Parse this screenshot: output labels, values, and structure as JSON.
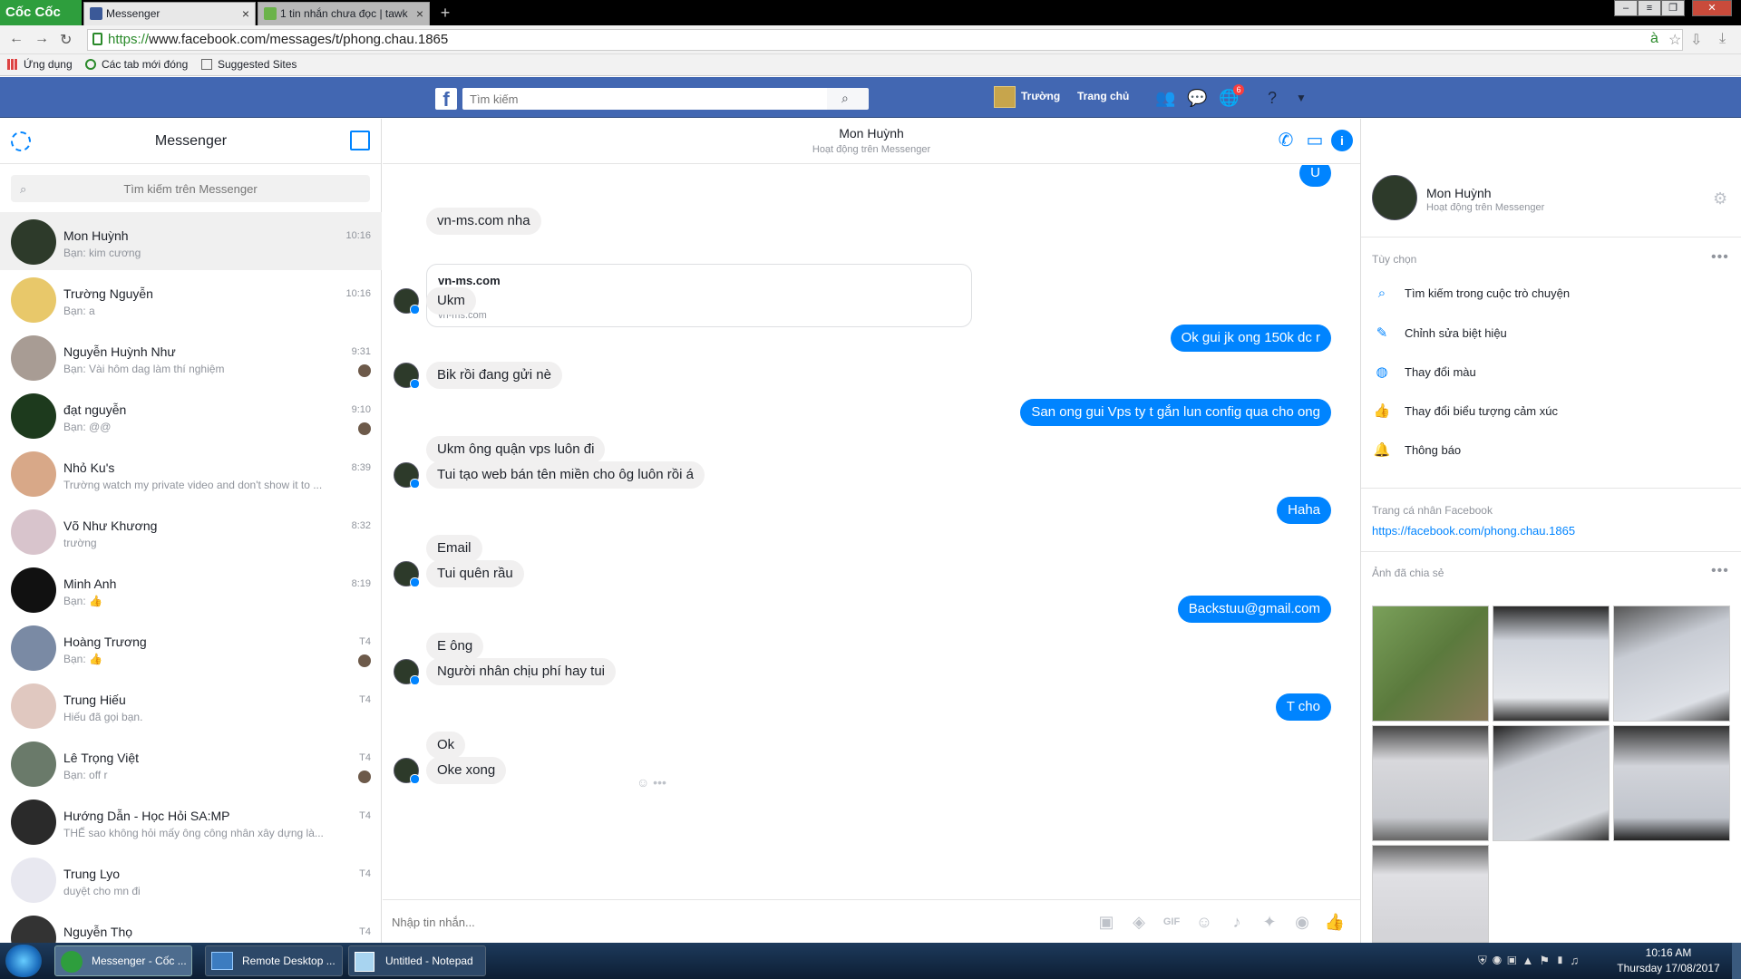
{
  "browser": {
    "logo": "Cốc Cốc",
    "tabs": [
      {
        "label": "Messenger",
        "active": true
      },
      {
        "label": "1 tin nhắn chưa đọc | tawk",
        "active": false
      }
    ],
    "url_https": "https://",
    "url_rest": "www.facebook.com/messages/t/phong.chau.1865",
    "bookmarks": [
      "Ứng dụng",
      "Các tab mới đóng",
      "Suggested Sites"
    ]
  },
  "fb": {
    "logo": "f",
    "search_placeholder": "Tìm kiếm",
    "user_name": "Trường",
    "home": "Trang chủ",
    "notif_count": "6"
  },
  "sidebar": {
    "title": "Messenger",
    "search_placeholder": "Tìm kiếm trên Messenger",
    "conversations": [
      {
        "name": "Mon Huỳnh",
        "snippet": "Bạn: kim cương",
        "time": "10:16",
        "color": "#2d3a2a"
      },
      {
        "name": "Trường Nguyễn",
        "snippet": "Bạn: a",
        "time": "10:16",
        "color": "#e8c86a"
      },
      {
        "name": "Nguyễn Huỳnh Như",
        "snippet": "Bạn: Vài hôm dag làm thí nghiệm",
        "time": "9:31",
        "color": "#a89c94"
      },
      {
        "name": "đạt nguyễn",
        "snippet": "Bạn: @@",
        "time": "9:10",
        "color": "#1d3a1d"
      },
      {
        "name": "Nhỏ Ku's",
        "snippet": "Trường watch my private video and don't show it to ...",
        "time": "8:39",
        "color": "#d8a888"
      },
      {
        "name": "Võ Như Khương",
        "snippet": "trường",
        "time": "8:32",
        "color": "#d8c4cc"
      },
      {
        "name": "Minh Anh",
        "snippet": "Bạn: 👍",
        "time": "8:19",
        "color": "#111111"
      },
      {
        "name": "Hoàng Trương",
        "snippet": "Bạn: 👍",
        "time": "T4",
        "color": "#7a8aa4"
      },
      {
        "name": "Trung Hiếu",
        "snippet": "Hiếu đã gọi bạn.",
        "time": "T4",
        "color": "#e0c8c0"
      },
      {
        "name": "Lê Trọng Việt",
        "snippet": "Bạn: off r",
        "time": "T4",
        "color": "#6a7a6a"
      },
      {
        "name": "Hướng Dẫn - Học Hỏi SA:MP",
        "snippet": "THẾ sao không hỏi mấy ông công nhân xây dựng là...",
        "time": "T4",
        "color": "#2a2a2a"
      },
      {
        "name": "Trung Lyo",
        "snippet": "duyệt cho mn đi",
        "time": "T4",
        "color": "#e8e8f0"
      },
      {
        "name": "Nguyễn Thọ",
        "snippet": "",
        "time": "T4",
        "color": "#333333"
      }
    ]
  },
  "chat": {
    "name": "Mon Huỳnh",
    "status": "Hoạt động trên Messenger",
    "link_card": {
      "title": "vn-ms.com",
      "source": "vn-ms.com"
    },
    "messages": [
      {
        "text": "U",
        "dir": "out"
      },
      {
        "text": "vn-ms.com nha",
        "dir": "in"
      },
      {
        "text": "Ukm",
        "dir": "in"
      },
      {
        "text": "Ok gui jk ong 150k dc r",
        "dir": "out"
      },
      {
        "text": "Bik rồi đang gửi nè",
        "dir": "in"
      },
      {
        "text": "San ong gui Vps ty t gắn lun config qua cho ong",
        "dir": "out"
      },
      {
        "text": "Ukm ông quận vps luôn đi",
        "dir": "in"
      },
      {
        "text": "Tui tạo web bán tên miền cho ôg luôn rồi á",
        "dir": "in"
      },
      {
        "text": "Haha",
        "dir": "out"
      },
      {
        "text": "Email",
        "dir": "in"
      },
      {
        "text": "Tui quên rầu",
        "dir": "in"
      },
      {
        "text": "Backstuu@gmail.com",
        "dir": "out"
      },
      {
        "text": "E ông",
        "dir": "in"
      },
      {
        "text": "Người nhân chịu phí hay tui",
        "dir": "in"
      },
      {
        "text": "T cho",
        "dir": "out"
      },
      {
        "text": "Ok",
        "dir": "in"
      },
      {
        "text": "Oke xong",
        "dir": "in"
      }
    ],
    "input_placeholder": "Nhập tin nhắn..."
  },
  "right_panel": {
    "name": "Mon Huỳnh",
    "status": "Hoạt động trên Messenger",
    "options_title": "Tùy chọn",
    "options": [
      "Tìm kiếm trong cuộc trò chuyện",
      "Chỉnh sửa biệt hiệu",
      "Thay đổi màu",
      "Thay đổi biểu tượng cảm xúc",
      "Thông báo"
    ],
    "profile_title": "Trang cá nhân Facebook",
    "profile_link": "https://facebook.com/phong.chau.1865",
    "photos_title": "Ảnh đã chia sẻ"
  },
  "taskbar": {
    "items": [
      "Messenger - Cốc ...",
      "Remote Desktop ...",
      "Untitled - Notepad"
    ],
    "time": "10:16 AM",
    "date": "Thursday 17/08/2017"
  }
}
